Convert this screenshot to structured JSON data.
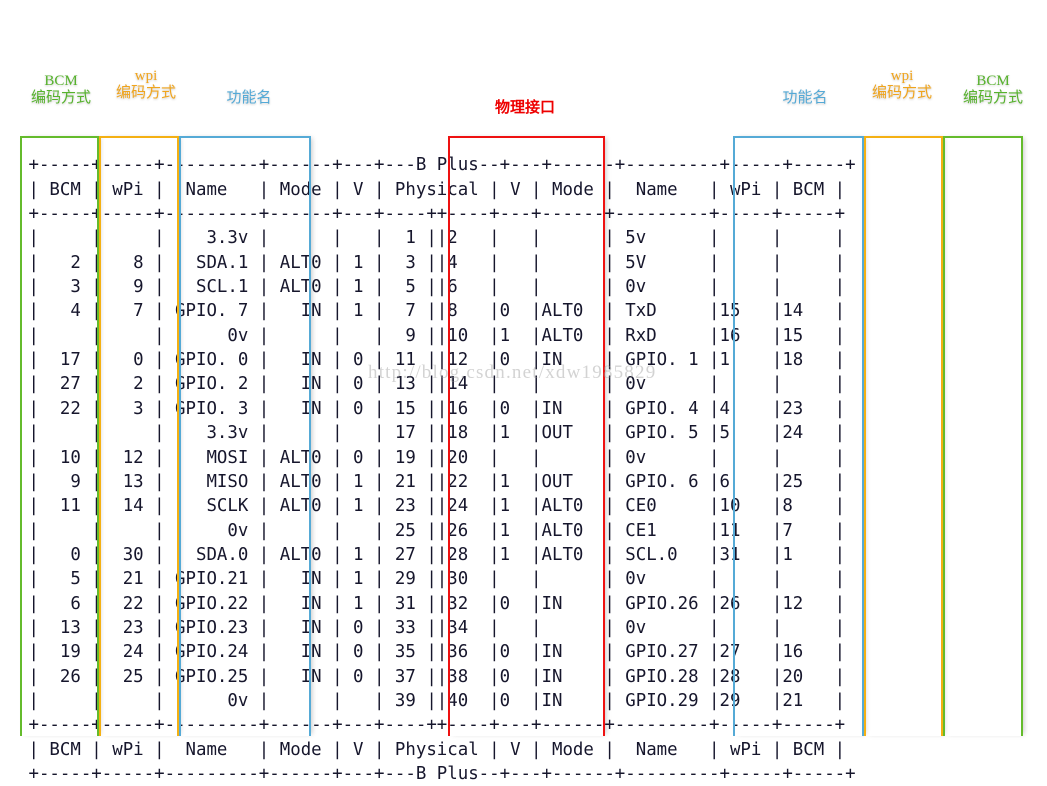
{
  "meta": {
    "board": "B Plus",
    "watermark": "http://blog.csdn.net/xdw1985829"
  },
  "annotations": {
    "left_bcm": {
      "line1": "BCM",
      "line2": "编码方式",
      "color": "#56b22c"
    },
    "left_wpi": {
      "line1": "wpi",
      "line2": "编码方式",
      "color": "#f0a41c"
    },
    "left_name": {
      "line1": "功能名",
      "line2": "",
      "color": "#54a9d6"
    },
    "physical": {
      "line1": "物理接口",
      "line2": "",
      "color": "#ee0000"
    },
    "right_name": {
      "line1": "功能名",
      "line2": "",
      "color": "#54a9d6"
    },
    "right_wpi": {
      "line1": "wpi",
      "line2": "编码方式",
      "color": "#f0a41c"
    },
    "right_bcm": {
      "line1": "BCM",
      "line2": "编码方式",
      "color": "#56b22c"
    }
  },
  "table": {
    "title_line": " +-----+-----+---------+------+---+---B Plus--+---+------+---------+-----+-----+",
    "header_line": " | BCM | wPi |   Name  | Mode | V | Physical | V | Mode | Name    | wPi | BCM |",
    "separator_line": " +-----+-----+---------+------+---+----++----+---+------+---------+-----+-----+",
    "columns": [
      "BCM",
      "wPi",
      "Name",
      "Mode",
      "V",
      "Physical",
      "V",
      "Mode",
      "Name",
      "wPi",
      "BCM"
    ],
    "rows": [
      {
        "bcm_l": "",
        "wpi_l": "",
        "name_l": "3.3v",
        "mode_l": "",
        "v_l": "",
        "phys_l": "1",
        "phys_r": "2",
        "v_r": "",
        "mode_r": "",
        "name_r": "5v",
        "wpi_r": "",
        "bcm_r": ""
      },
      {
        "bcm_l": "2",
        "wpi_l": "8",
        "name_l": "SDA.1",
        "mode_l": "ALT0",
        "v_l": "1",
        "phys_l": "3",
        "phys_r": "4",
        "v_r": "",
        "mode_r": "",
        "name_r": "5V",
        "wpi_r": "",
        "bcm_r": ""
      },
      {
        "bcm_l": "3",
        "wpi_l": "9",
        "name_l": "SCL.1",
        "mode_l": "ALT0",
        "v_l": "1",
        "phys_l": "5",
        "phys_r": "6",
        "v_r": "",
        "mode_r": "",
        "name_r": "0v",
        "wpi_r": "",
        "bcm_r": ""
      },
      {
        "bcm_l": "4",
        "wpi_l": "7",
        "name_l": "GPIO. 7",
        "mode_l": "IN",
        "v_l": "1",
        "phys_l": "7",
        "phys_r": "8",
        "v_r": "0",
        "mode_r": "ALT0",
        "name_r": "TxD",
        "wpi_r": "15",
        "bcm_r": "14"
      },
      {
        "bcm_l": "",
        "wpi_l": "",
        "name_l": "0v",
        "mode_l": "",
        "v_l": "",
        "phys_l": "9",
        "phys_r": "10",
        "v_r": "1",
        "mode_r": "ALT0",
        "name_r": "RxD",
        "wpi_r": "16",
        "bcm_r": "15"
      },
      {
        "bcm_l": "17",
        "wpi_l": "0",
        "name_l": "GPIO. 0",
        "mode_l": "IN",
        "v_l": "0",
        "phys_l": "11",
        "phys_r": "12",
        "v_r": "0",
        "mode_r": "IN",
        "name_r": "GPIO. 1",
        "wpi_r": "1",
        "bcm_r": "18"
      },
      {
        "bcm_l": "27",
        "wpi_l": "2",
        "name_l": "GPIO. 2",
        "mode_l": "IN",
        "v_l": "0",
        "phys_l": "13",
        "phys_r": "14",
        "v_r": "",
        "mode_r": "",
        "name_r": "0v",
        "wpi_r": "",
        "bcm_r": ""
      },
      {
        "bcm_l": "22",
        "wpi_l": "3",
        "name_l": "GPIO. 3",
        "mode_l": "IN",
        "v_l": "0",
        "phys_l": "15",
        "phys_r": "16",
        "v_r": "0",
        "mode_r": "IN",
        "name_r": "GPIO. 4",
        "wpi_r": "4",
        "bcm_r": "23"
      },
      {
        "bcm_l": "",
        "wpi_l": "",
        "name_l": "3.3v",
        "mode_l": "",
        "v_l": "",
        "phys_l": "17",
        "phys_r": "18",
        "v_r": "1",
        "mode_r": "OUT",
        "name_r": "GPIO. 5",
        "wpi_r": "5",
        "bcm_r": "24"
      },
      {
        "bcm_l": "10",
        "wpi_l": "12",
        "name_l": "MOSI",
        "mode_l": "ALT0",
        "v_l": "0",
        "phys_l": "19",
        "phys_r": "20",
        "v_r": "",
        "mode_r": "",
        "name_r": "0v",
        "wpi_r": "",
        "bcm_r": ""
      },
      {
        "bcm_l": "9",
        "wpi_l": "13",
        "name_l": "MISO",
        "mode_l": "ALT0",
        "v_l": "1",
        "phys_l": "21",
        "phys_r": "22",
        "v_r": "1",
        "mode_r": "OUT",
        "name_r": "GPIO. 6",
        "wpi_r": "6",
        "bcm_r": "25"
      },
      {
        "bcm_l": "11",
        "wpi_l": "14",
        "name_l": "SCLK",
        "mode_l": "ALT0",
        "v_l": "1",
        "phys_l": "23",
        "phys_r": "24",
        "v_r": "1",
        "mode_r": "ALT0",
        "name_r": "CE0",
        "wpi_r": "10",
        "bcm_r": "8"
      },
      {
        "bcm_l": "",
        "wpi_l": "",
        "name_l": "0v",
        "mode_l": "",
        "v_l": "",
        "phys_l": "25",
        "phys_r": "26",
        "v_r": "1",
        "mode_r": "ALT0",
        "name_r": "CE1",
        "wpi_r": "11",
        "bcm_r": "7"
      },
      {
        "bcm_l": "0",
        "wpi_l": "30",
        "name_l": "SDA.0",
        "mode_l": "ALT0",
        "v_l": "1",
        "phys_l": "27",
        "phys_r": "28",
        "v_r": "1",
        "mode_r": "ALT0",
        "name_r": "SCL.0",
        "wpi_r": "31",
        "bcm_r": "1"
      },
      {
        "bcm_l": "5",
        "wpi_l": "21",
        "name_l": "GPIO.21",
        "mode_l": "IN",
        "v_l": "1",
        "phys_l": "29",
        "phys_r": "30",
        "v_r": "",
        "mode_r": "",
        "name_r": "0v",
        "wpi_r": "",
        "bcm_r": ""
      },
      {
        "bcm_l": "6",
        "wpi_l": "22",
        "name_l": "GPIO.22",
        "mode_l": "IN",
        "v_l": "1",
        "phys_l": "31",
        "phys_r": "32",
        "v_r": "0",
        "mode_r": "IN",
        "name_r": "GPIO.26",
        "wpi_r": "26",
        "bcm_r": "12"
      },
      {
        "bcm_l": "13",
        "wpi_l": "23",
        "name_l": "GPIO.23",
        "mode_l": "IN",
        "v_l": "0",
        "phys_l": "33",
        "phys_r": "34",
        "v_r": "",
        "mode_r": "",
        "name_r": "0v",
        "wpi_r": "",
        "bcm_r": ""
      },
      {
        "bcm_l": "19",
        "wpi_l": "24",
        "name_l": "GPIO.24",
        "mode_l": "IN",
        "v_l": "0",
        "phys_l": "35",
        "phys_r": "36",
        "v_r": "0",
        "mode_r": "IN",
        "name_r": "GPIO.27",
        "wpi_r": "27",
        "bcm_r": "16"
      },
      {
        "bcm_l": "26",
        "wpi_l": "25",
        "name_l": "GPIO.25",
        "mode_l": "IN",
        "v_l": "0",
        "phys_l": "37",
        "phys_r": "38",
        "v_r": "0",
        "mode_r": "IN",
        "name_r": "GPIO.28",
        "wpi_r": "28",
        "bcm_r": "20"
      },
      {
        "bcm_l": "",
        "wpi_l": "",
        "name_l": "0v",
        "mode_l": "",
        "v_l": "",
        "phys_l": "39",
        "phys_r": "40",
        "v_r": "0",
        "mode_r": "IN",
        "name_r": "GPIO.29",
        "wpi_r": "29",
        "bcm_r": "21"
      }
    ],
    "footer_title_line": " +-----+-----+---------+------+---+----++----+---+------+---------+-----+-----+",
    "footer_board_line": " +-----+-----+---------+------+---+---B Plus--+---+------+---------+-----+-----+"
  },
  "ascii_art": [
    " +-----+-----+---------+------+---+---B Plus--+---+------+---------+-----+-----+",
    " | BCM | wPi |   Name  | Mode | V | Physical  | V | Mode | Name    | wPi | BCM |",
    " +-----+-----+---------+------+---+----++-----+---+------+---------+-----+-----+"
  ]
}
